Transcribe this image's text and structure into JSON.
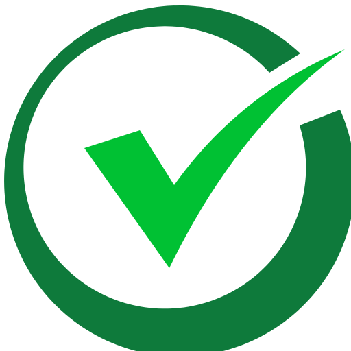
{
  "icon": {
    "name": "check-circle-icon",
    "ring_color": "#0e7a3b",
    "check_color": "#00c133",
    "background_color": "#ffffff"
  }
}
